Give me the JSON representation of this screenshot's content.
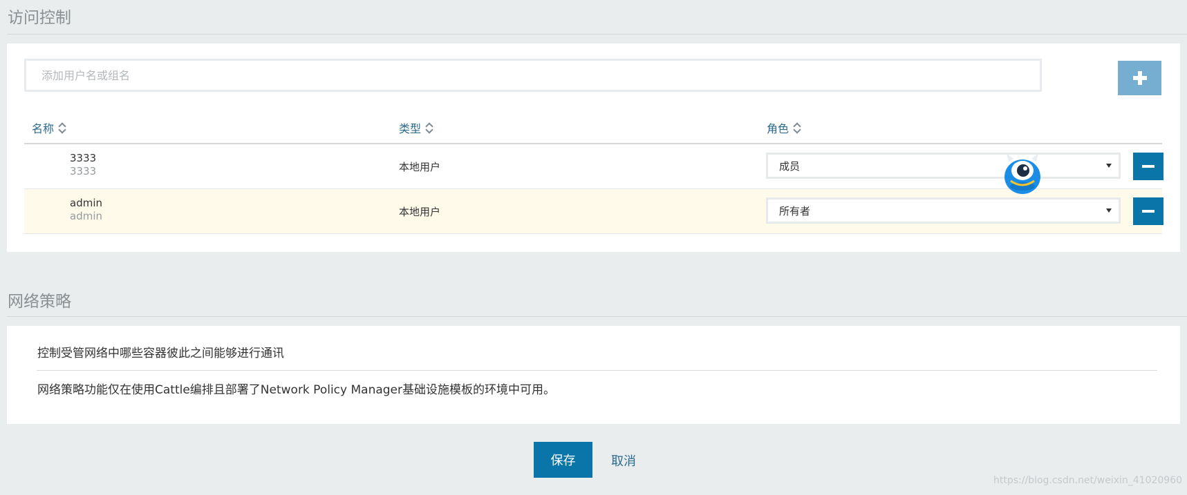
{
  "access_control": {
    "title": "访问控制",
    "search": {
      "placeholder": "添加用户名或组名",
      "value": ""
    },
    "add_button_icon": "plus-icon",
    "table": {
      "headers": {
        "name": "名称",
        "type": "类型",
        "role": "角色"
      },
      "rows": [
        {
          "name": "3333",
          "sub": "3333",
          "type": "本地用户",
          "role": "成员",
          "highlighted": false
        },
        {
          "name": "admin",
          "sub": "admin",
          "type": "本地用户",
          "role": "所有者",
          "highlighted": true
        }
      ]
    }
  },
  "network_policy": {
    "title": "网络策略",
    "description": "控制受管网络中哪些容器彼此之间能够进行通讯",
    "note": "网络策略功能仅在使用Cattle编排且部署了Network Policy Manager基础设施模板的环境中可用。"
  },
  "actions": {
    "save": "保存",
    "cancel": "取消"
  },
  "watermark": "https://blog.csdn.net/weixin_41020960",
  "colors": {
    "primary": "#0a75a8",
    "add_button": "#75aed0",
    "highlight_row": "#fffaea",
    "background": "#e9edee"
  }
}
